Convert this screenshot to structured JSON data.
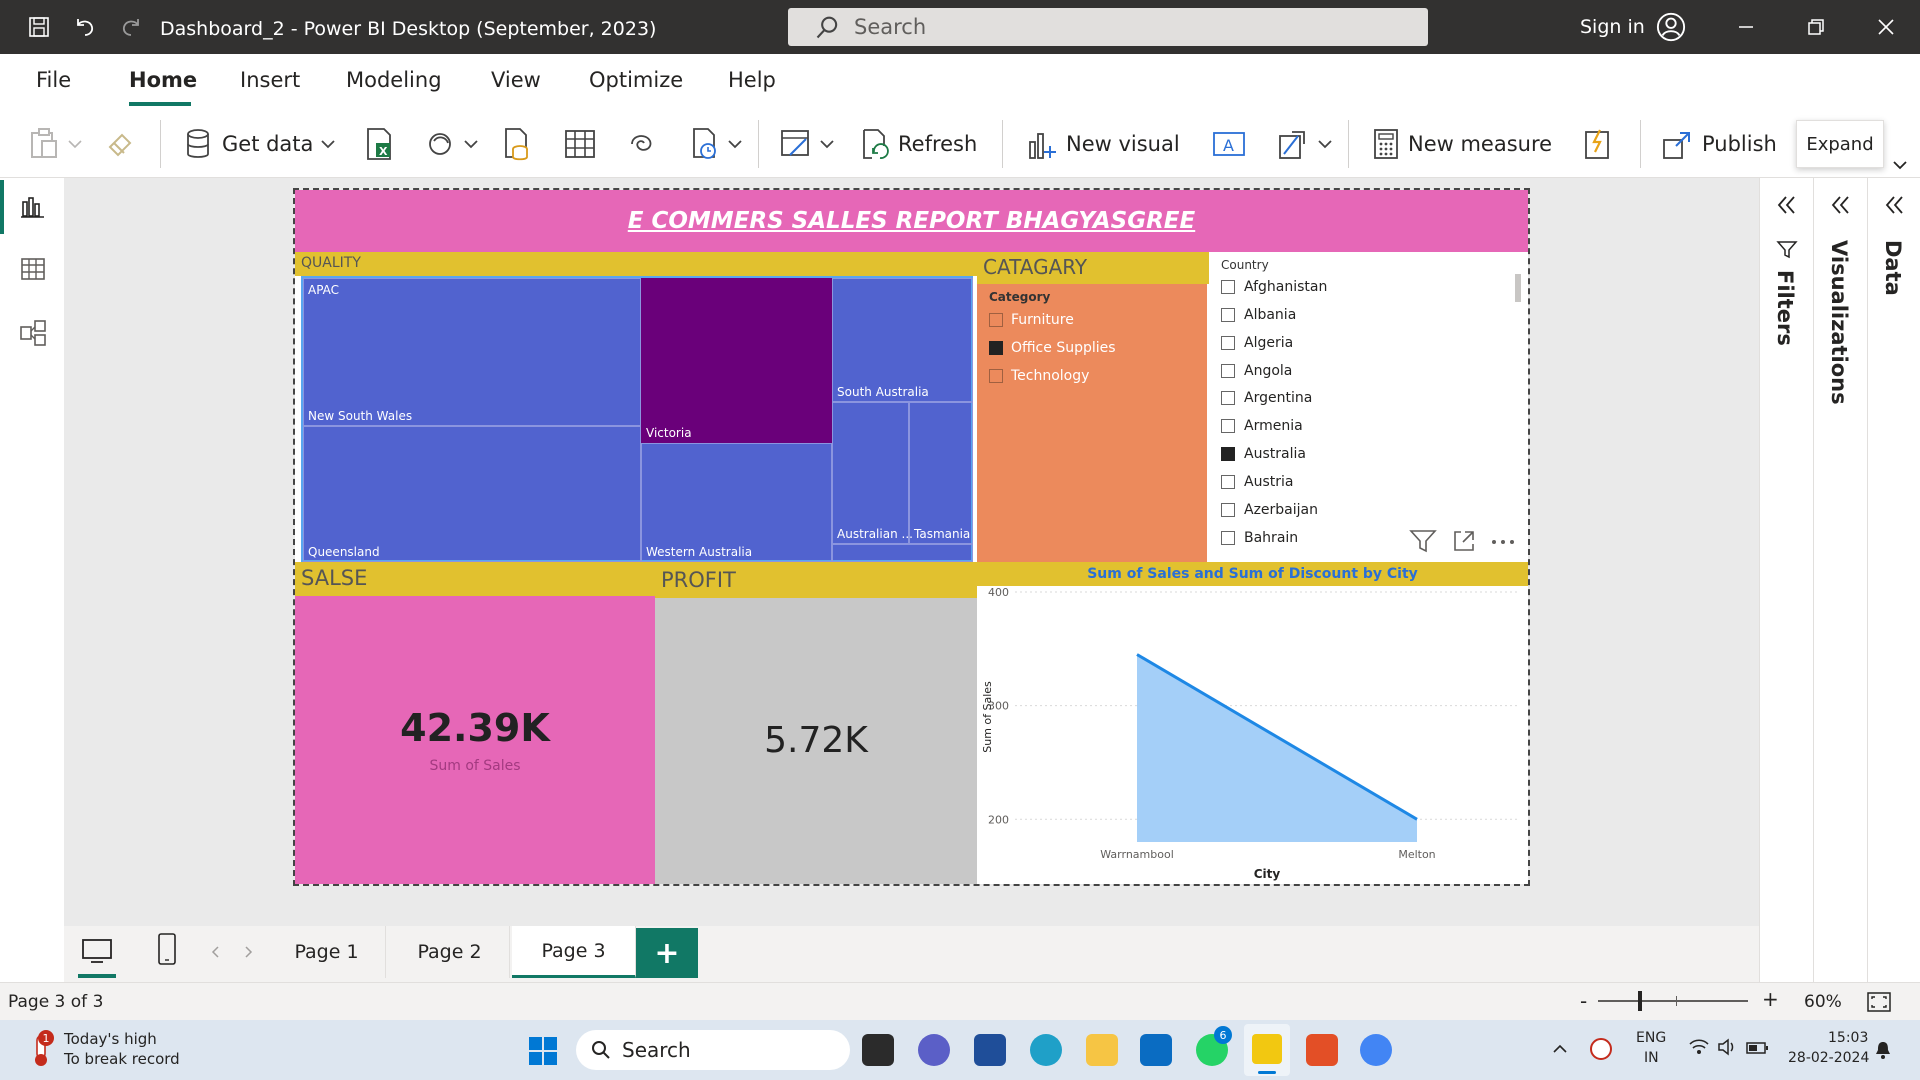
{
  "window": {
    "title": "Dashboard_2 - Power BI Desktop (September, 2023)",
    "search_placeholder": "Search",
    "sign_in": "Sign in"
  },
  "menu": {
    "tabs": [
      "File",
      "Home",
      "Insert",
      "Modeling",
      "View",
      "Optimize",
      "Help"
    ],
    "active": "Home"
  },
  "ribbon": {
    "get_data": "Get data",
    "refresh": "Refresh",
    "new_visual": "New visual",
    "new_measure": "New measure",
    "publish": "Publish",
    "expand_tooltip": "Expand"
  },
  "report": {
    "title": "E COMMERS SALLES REPORT BHAGYASGREE",
    "treemap": {
      "header": "QUALITY",
      "tiles": [
        "APAC",
        "New South Wales",
        "Queensland",
        "Victoria",
        "Western Australia",
        "South Australia",
        "Australian ...",
        "Tasmania"
      ],
      "colors": {
        "base": "#5163cf",
        "highlight": "#6a007a"
      }
    },
    "category_slicer": {
      "header": "CATAGARY",
      "field": "Category",
      "items": [
        {
          "label": "Furniture",
          "checked": false
        },
        {
          "label": "Office Supplies",
          "checked": true
        },
        {
          "label": "Technology",
          "checked": false
        }
      ]
    },
    "country_slicer": {
      "field": "Country",
      "items": [
        {
          "label": "Afghanistan",
          "checked": false
        },
        {
          "label": "Albania",
          "checked": false
        },
        {
          "label": "Algeria",
          "checked": false
        },
        {
          "label": "Angola",
          "checked": false
        },
        {
          "label": "Argentina",
          "checked": false
        },
        {
          "label": "Armenia",
          "checked": false
        },
        {
          "label": "Australia",
          "checked": true
        },
        {
          "label": "Austria",
          "checked": false
        },
        {
          "label": "Azerbaijan",
          "checked": false
        },
        {
          "label": "Bahrain",
          "checked": false
        }
      ]
    },
    "sales_card": {
      "header": "SALSE",
      "value": "42.39K",
      "label": "Sum of Sales"
    },
    "profit_card": {
      "header": "PROFIT",
      "value": "5.72K"
    }
  },
  "chart_data": {
    "type": "area",
    "title": "Sum of Sales and Sum of Discount by City",
    "xlabel": "City",
    "ylabel": "Sum of Sales",
    "categories": [
      "Warrnambool",
      "Melton"
    ],
    "series": [
      {
        "values": [
          345,
          200
        ]
      }
    ],
    "yticks": [
      200,
      300,
      400
    ],
    "ylim": [
      180,
      400
    ],
    "color": "#1e88e5",
    "fill": "#a4cff8"
  },
  "panes": {
    "filters": "Filters",
    "visualizations": "Visualizations",
    "data": "Data"
  },
  "pages": {
    "tabs": [
      "Page 1",
      "Page 2",
      "Page 3"
    ],
    "active": "Page 3",
    "add": "+"
  },
  "status": {
    "page_indicator": "Page 3 of 3",
    "zoom": "60%",
    "zoom_minus": "-",
    "zoom_plus": "+"
  },
  "taskbar": {
    "weather_line1": "Today's high",
    "weather_line2": "To break record",
    "weather_badge": "1",
    "search": "Search",
    "lang_top": "ENG",
    "lang_bottom": "IN",
    "time": "15:03",
    "date": "28-02-2024",
    "whatsapp_badge": "6"
  }
}
